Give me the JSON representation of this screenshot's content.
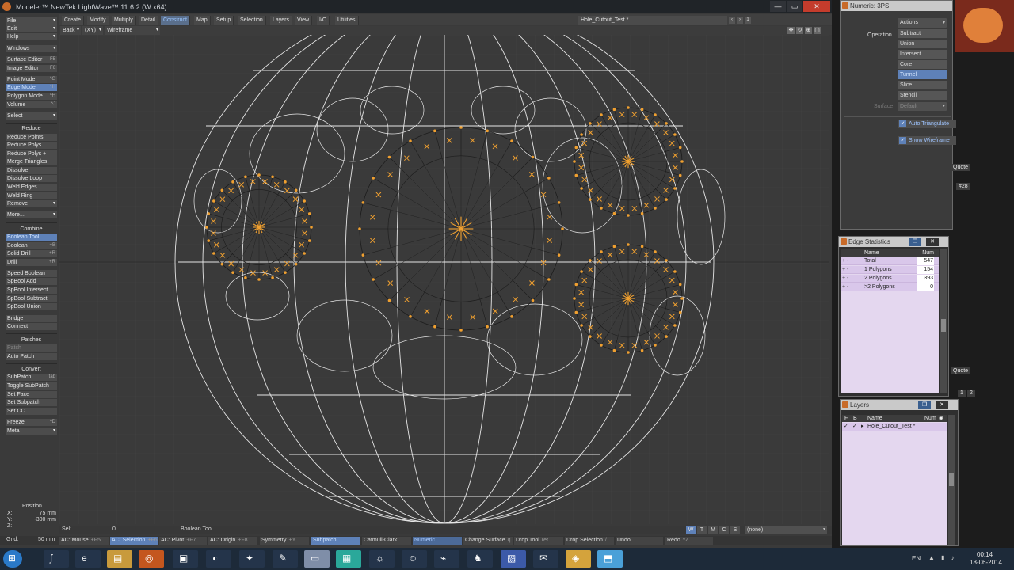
{
  "window": {
    "title": "Modeler™ NewTek LightWave™ 11.6.2 (W x64)",
    "minimize": "—",
    "maximize": "▭",
    "close": "✕"
  },
  "menu": {
    "file": "File",
    "edit": "Edit",
    "help": "Help",
    "windows": "Windows",
    "tabs": [
      "Create",
      "Modify",
      "Multiply",
      "Detail",
      "Construct",
      "Map",
      "Setup",
      "Selection",
      "Layers",
      "View",
      "I/O",
      "Utilities"
    ],
    "active_tab": "Construct",
    "layer_name": "Hole_Cutout_Test *",
    "layer_buttons": [
      "1",
      "2"
    ]
  },
  "viewport": {
    "view_direction": "Back",
    "axis": "(XY)",
    "render_mode": "Wireframe"
  },
  "toolbar": {
    "editors": [
      {
        "label": "Surface Editor",
        "shortcut": "F5"
      },
      {
        "label": "Image Editor",
        "shortcut": "F6"
      }
    ],
    "modes": [
      {
        "label": "Point Mode",
        "shortcut": "^G"
      },
      {
        "label": "Edge Mode",
        "shortcut": "^H"
      },
      {
        "label": "Polygon Mode",
        "shortcut": "^H"
      },
      {
        "label": "Volume",
        "shortcut": "^J"
      }
    ],
    "select": "Select",
    "reduce_header": "Reduce",
    "reduce": [
      "Reduce Points",
      "Reduce Polys",
      "Reduce Polys +",
      "Merge Triangles",
      "Dissolve",
      "Dissolve Loop",
      "Weld Edges",
      "Weld Ring",
      "Remove",
      "More..."
    ],
    "combine_header": "Combine",
    "combine": [
      {
        "label": "Boolean Tool",
        "shortcut": ""
      },
      {
        "label": "Boolean",
        "shortcut": "+B"
      },
      {
        "label": "Solid Drill",
        "shortcut": "+R"
      },
      {
        "label": "Drill",
        "shortcut": "+R"
      },
      {
        "label": "Speed Boolean",
        "shortcut": ""
      },
      {
        "label": "SpBool Add",
        "shortcut": ""
      },
      {
        "label": "SpBool Intersect",
        "shortcut": ""
      },
      {
        "label": "SpBool Subtract",
        "shortcut": ""
      },
      {
        "label": "SpBool Union",
        "shortcut": ""
      },
      {
        "label": "Bridge",
        "shortcut": ""
      },
      {
        "label": "Connect",
        "shortcut": "l"
      }
    ],
    "patches_header": "Patches",
    "patches": [
      "Patch",
      "Auto Patch"
    ],
    "convert_header": "Convert",
    "convert": [
      {
        "label": "SubPatch",
        "shortcut": "tab"
      },
      {
        "label": "Toggle SubPatch",
        "shortcut": ""
      },
      {
        "label": "Set Face",
        "shortcut": ""
      },
      {
        "label": "Set Subpatch",
        "shortcut": ""
      },
      {
        "label": "Set CC",
        "shortcut": ""
      }
    ],
    "freeze": {
      "label": "Freeze",
      "shortcut": "^D"
    },
    "meta": "Meta"
  },
  "position": {
    "label": "Position",
    "x_label": "X:",
    "x": "75 mm",
    "y_label": "Y:",
    "y": "-300 mm",
    "z_label": "Z:",
    "z": ""
  },
  "status": {
    "sel_label": "Sel:",
    "sel_value": "0",
    "tool": "Boolean Tool",
    "view_letters": [
      "W",
      "T",
      "M",
      "C",
      "S"
    ],
    "surface_dropdown": "(none)"
  },
  "bottom_bar": {
    "grid_label": "Grid:",
    "grid_value": "50 mm",
    "buttons": [
      {
        "label": "AC: Mouse",
        "shortcut": "+F5"
      },
      {
        "label": "AC: Selection",
        "shortcut": "+F6"
      },
      {
        "label": "AC: Pivot",
        "shortcut": "+F7"
      },
      {
        "label": "AC: Origin",
        "shortcut": "+F8"
      },
      {
        "label": "Symmetry",
        "shortcut": "+Y"
      },
      {
        "label": "Subpatch",
        "shortcut": ""
      },
      {
        "label": "Catmull-Clark",
        "shortcut": ""
      },
      {
        "label": "Numeric",
        "shortcut": ""
      },
      {
        "label": "Change Surface",
        "shortcut": "q"
      },
      {
        "label": "Drop Tool",
        "shortcut": "ret"
      },
      {
        "label": "Drop Selection",
        "shortcut": "/"
      },
      {
        "label": "Undo",
        "shortcut": ""
      },
      {
        "label": "Redo",
        "shortcut": "^Z"
      }
    ]
  },
  "numeric_panel": {
    "title": "Numeric: 3PS",
    "operation_label": "Operation",
    "actions_dropdown": "Actions",
    "options": [
      "Subtract",
      "Union",
      "Intersect",
      "Core",
      "Tunnel",
      "Slice",
      "Stencil"
    ],
    "selected_option": "Tunnel",
    "surface_label": "Surface",
    "surface_value": "Default",
    "auto_triangulate": "Auto Triangulate",
    "show_wireframe": "Show Wireframe"
  },
  "edge_panel": {
    "title": "Edge Statistics",
    "col_name": "Name",
    "col_num": "Num",
    "rows": [
      {
        "name": "Total",
        "num": "547"
      },
      {
        "name": "1 Polygons",
        "num": "154"
      },
      {
        "name": "2 Polygons",
        "num": "393"
      },
      {
        "name": ">2 Polygons",
        "num": "0"
      }
    ]
  },
  "layers_panel": {
    "title": "Layers",
    "col_f": "F",
    "col_b": "B",
    "col_name": "Name",
    "col_num": "Num",
    "rows": [
      {
        "name": "Hole_Cutout_Test *",
        "num": ""
      }
    ]
  },
  "side_labels": {
    "quote_1": "Quote",
    "count_1": "#28",
    "quote_2": "Quote",
    "page_1": "1",
    "page_2": "2"
  },
  "taskbar": {
    "language": "EN",
    "time": "00:14",
    "date": "18-06-2014"
  },
  "colors": {
    "accent": "#5e81b8",
    "wire": "#e8e8e8",
    "vertex_highlight": "#f0a030",
    "close": "#c43c2c"
  }
}
